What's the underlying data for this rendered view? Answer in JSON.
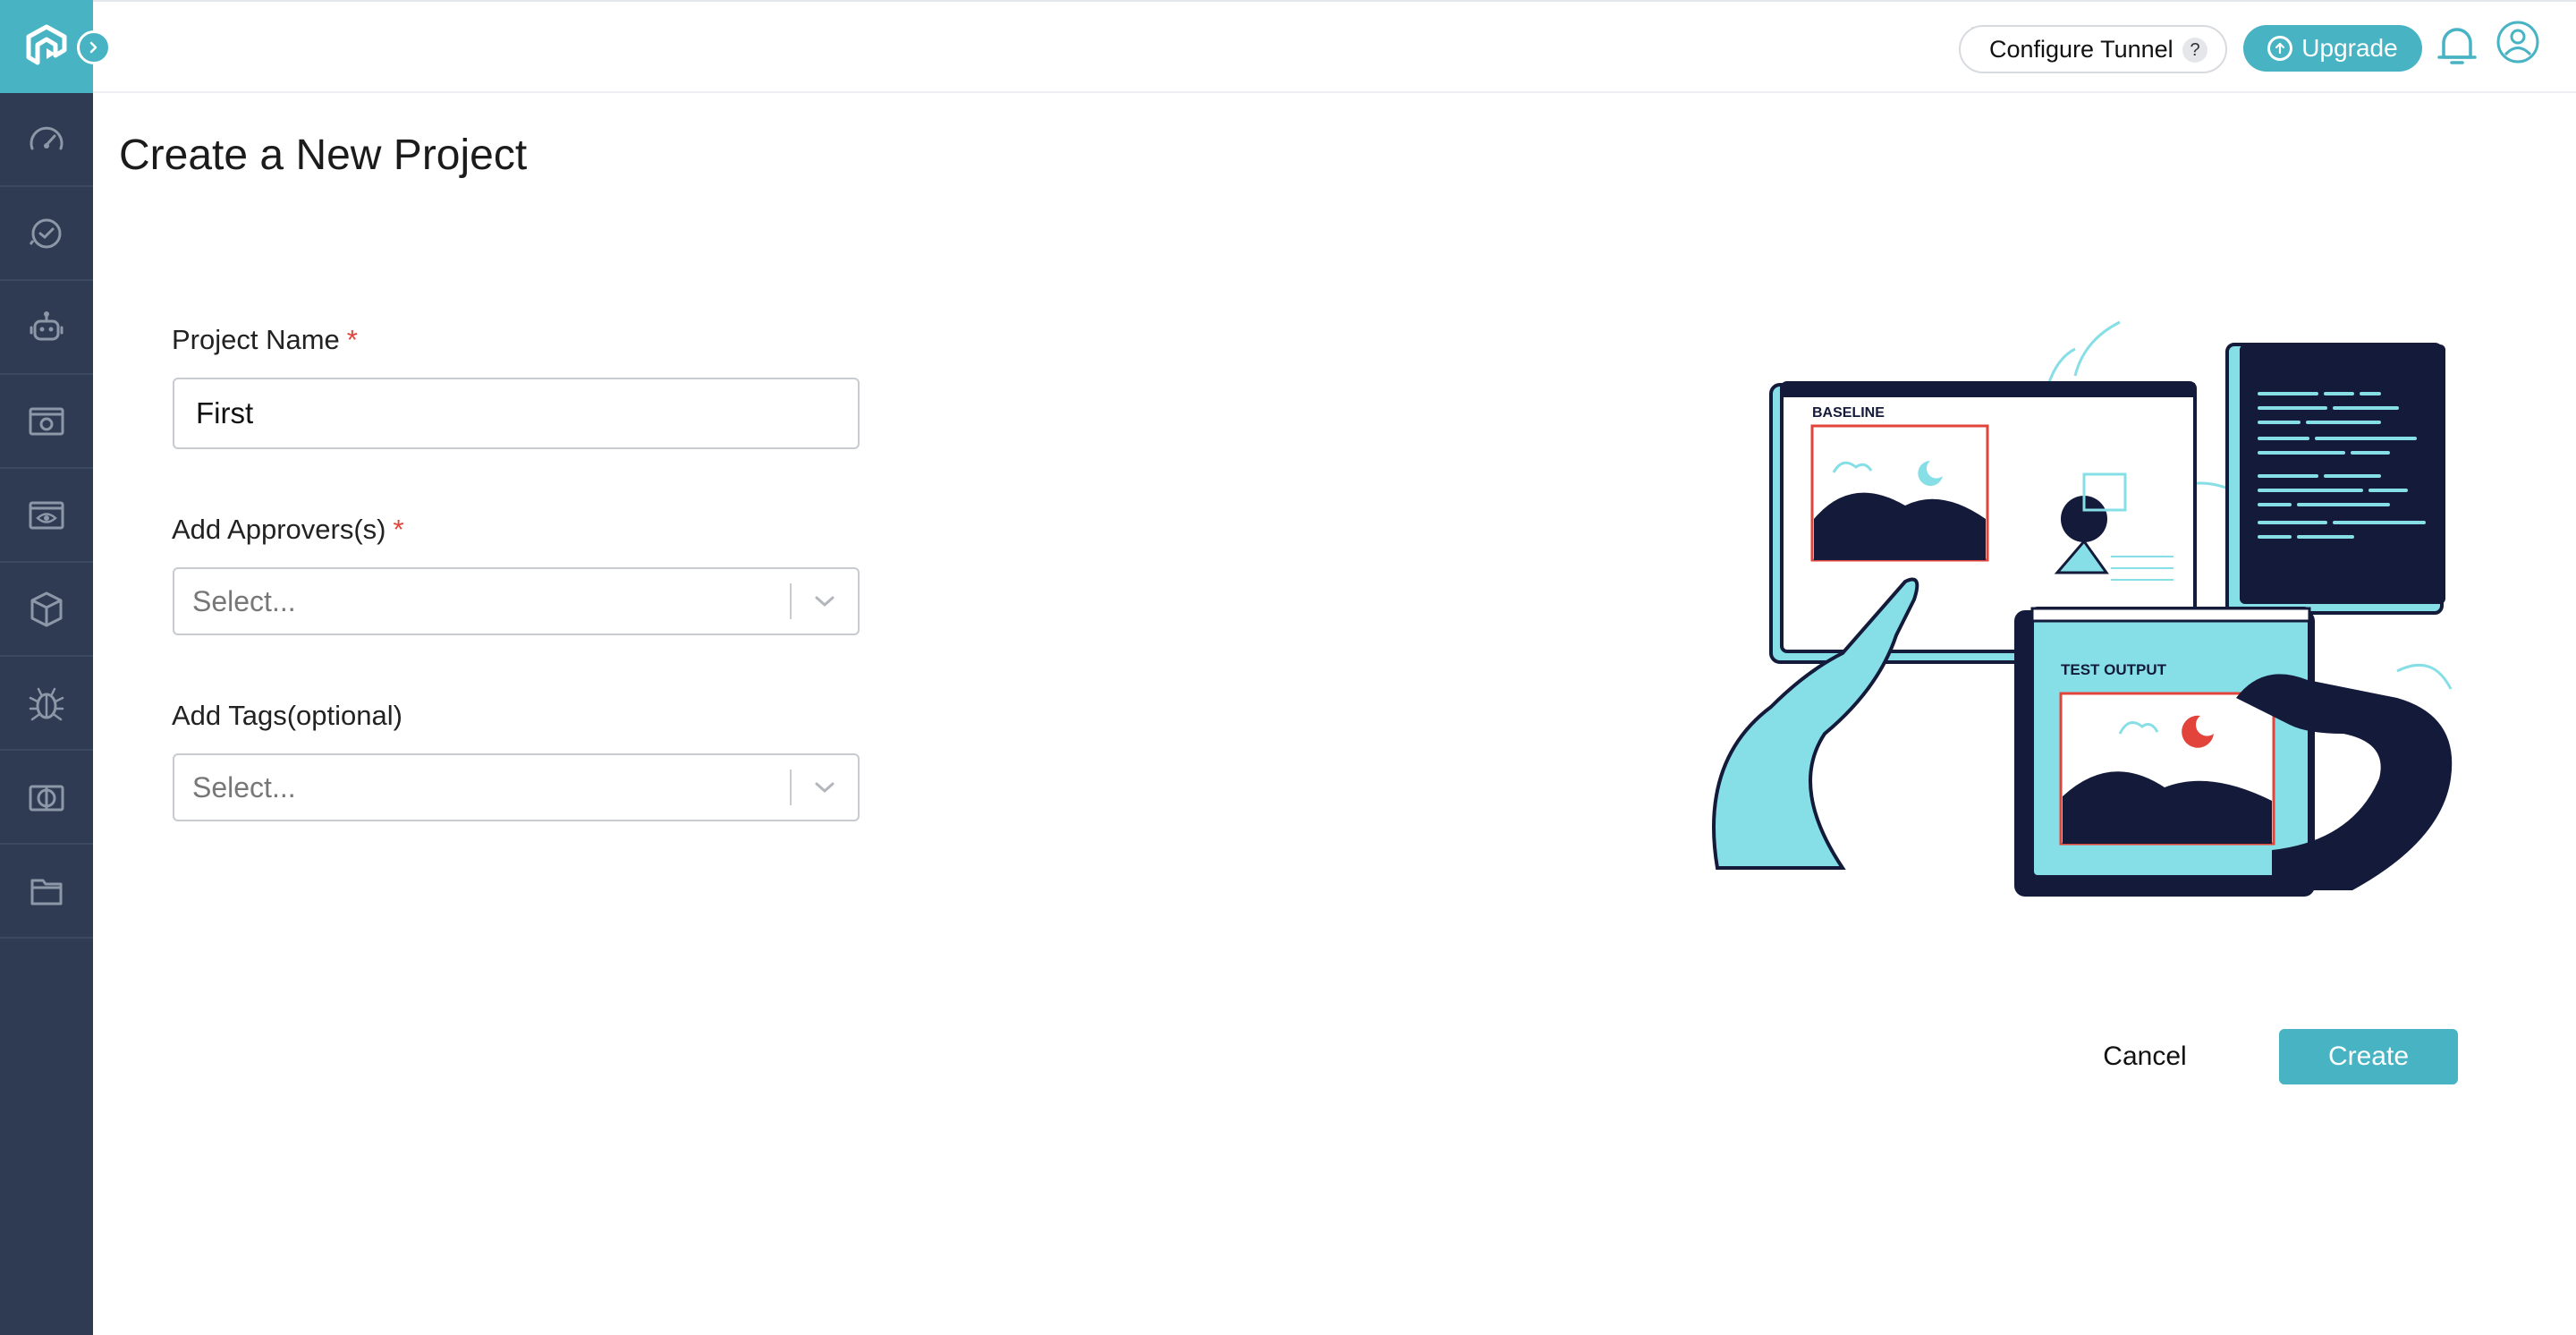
{
  "header": {
    "configure_tunnel_label": "Configure Tunnel",
    "help_badge": "?",
    "upgrade_label": "Upgrade",
    "icons": [
      "apps-grid-icon",
      "bell-icon",
      "user-icon",
      "upgrade-arrow-icon"
    ]
  },
  "sidebar": {
    "logo": "lambdatest-logo",
    "expand_icon": "chevron-right-icon",
    "items": [
      {
        "icon": "speedometer-icon"
      },
      {
        "icon": "clock-history-icon"
      },
      {
        "icon": "robot-icon"
      },
      {
        "icon": "browser-gear-icon"
      },
      {
        "icon": "eye-window-icon"
      },
      {
        "icon": "cube-icon"
      },
      {
        "icon": "bug-icon"
      },
      {
        "icon": "compare-icon"
      },
      {
        "icon": "folder-icon"
      }
    ]
  },
  "page": {
    "title": "Create a New Project"
  },
  "form": {
    "project_name_label": "Project Name",
    "project_name_value": "First",
    "required_marker": "*",
    "approvers_label": "Add Approvers(s)",
    "approvers_placeholder": "Select...",
    "tags_label": "Add Tags(optional)",
    "tags_placeholder": "Select..."
  },
  "illustration": {
    "baseline_label": "BASELINE",
    "test_output_label": "TEST OUTPUT",
    "colors": {
      "navy": "#141a3a",
      "cyan": "#86dfe6",
      "red": "#e2443b"
    }
  },
  "actions": {
    "cancel_label": "Cancel",
    "create_label": "Create"
  },
  "colors": {
    "accent": "#47b3c3",
    "sidebar": "#2e3b52",
    "required": "#e2443b"
  }
}
